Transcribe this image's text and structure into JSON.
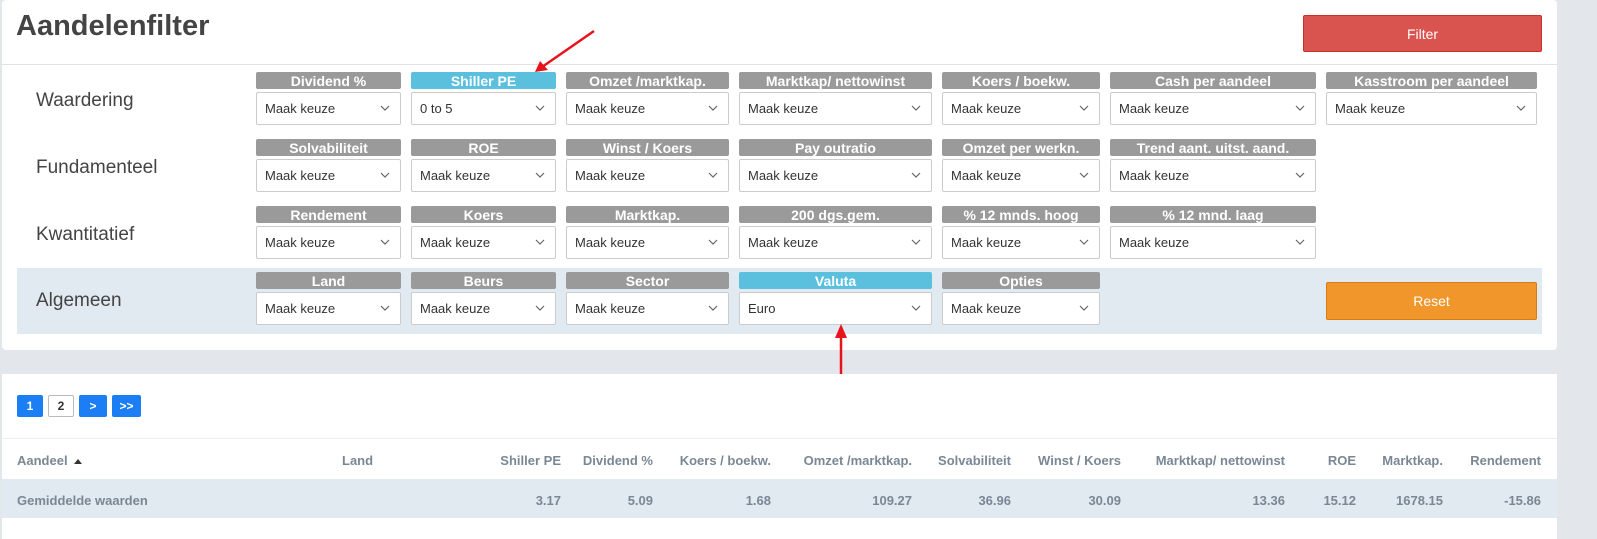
{
  "header": {
    "title": "Aandelenfilter",
    "filter_label": "Filter"
  },
  "rows": {
    "waardering": "Waardering",
    "fundamenteel": "Fundamenteel",
    "kwantitatief": "Kwantitatief",
    "algemeen": "Algemeen"
  },
  "filters": {
    "waardering": [
      {
        "label": "Dividend %",
        "value": "Maak keuze"
      },
      {
        "label": "Shiller PE",
        "value": "0 to 5",
        "active": true
      },
      {
        "label": "Omzet /marktkap.",
        "value": "Maak keuze"
      },
      {
        "label": "Marktkap/ nettowinst",
        "value": "Maak keuze"
      },
      {
        "label": "Koers / boekw.",
        "value": "Maak keuze"
      },
      {
        "label": "Cash per aandeel",
        "value": "Maak keuze"
      },
      {
        "label": "Kasstroom per aandeel",
        "value": "Maak keuze"
      }
    ],
    "fundamenteel": [
      {
        "label": "Solvabiliteit",
        "value": "Maak keuze"
      },
      {
        "label": "ROE",
        "value": "Maak keuze"
      },
      {
        "label": "Winst / Koers",
        "value": "Maak keuze"
      },
      {
        "label": "Pay outratio",
        "value": "Maak keuze"
      },
      {
        "label": "Omzet per werkn.",
        "value": "Maak keuze"
      },
      {
        "label": "Trend aant. uitst. aand.",
        "value": "Maak keuze"
      }
    ],
    "kwantitatief": [
      {
        "label": "Rendement",
        "value": "Maak keuze"
      },
      {
        "label": "Koers",
        "value": "Maak keuze"
      },
      {
        "label": "Marktkap.",
        "value": "Maak keuze"
      },
      {
        "label": "200 dgs.gem.",
        "value": "Maak keuze"
      },
      {
        "label": "% 12 mnds. hoog",
        "value": "Maak keuze"
      },
      {
        "label": "% 12 mnd. laag",
        "value": "Maak keuze"
      }
    ],
    "algemeen": [
      {
        "label": "Land",
        "value": "Maak keuze"
      },
      {
        "label": "Beurs",
        "value": "Maak keuze"
      },
      {
        "label": "Sector",
        "value": "Maak keuze"
      },
      {
        "label": "Valuta",
        "value": "Euro",
        "active": true
      },
      {
        "label": "Opties",
        "value": "Maak keuze"
      }
    ]
  },
  "reset_label": "Reset",
  "pagination": [
    "1",
    "2",
    ">",
    ">>"
  ],
  "table": {
    "headers": [
      "Aandeel",
      "Land",
      "Shiller PE",
      "Dividend %",
      "Koers / boekw.",
      "Omzet /marktkap.",
      "Solvabiliteit",
      "Winst / Koers",
      "Marktkap/ nettowinst",
      "ROE",
      "Marktkap.",
      "Rendement"
    ],
    "average_row": {
      "label": "Gemiddelde waarden",
      "values": [
        "3.17",
        "5.09",
        "1.68",
        "109.27",
        "36.96",
        "30.09",
        "13.36",
        "15.12",
        "1678.15",
        "-15.86"
      ]
    }
  },
  "colors": {
    "filter_button": "#d9534f",
    "reset_button": "#f0962b",
    "active_label": "#5bc0de",
    "label": "#9a9a9a",
    "pager_active": "#1b7ef5",
    "annotation_arrow": "#e8141c"
  }
}
